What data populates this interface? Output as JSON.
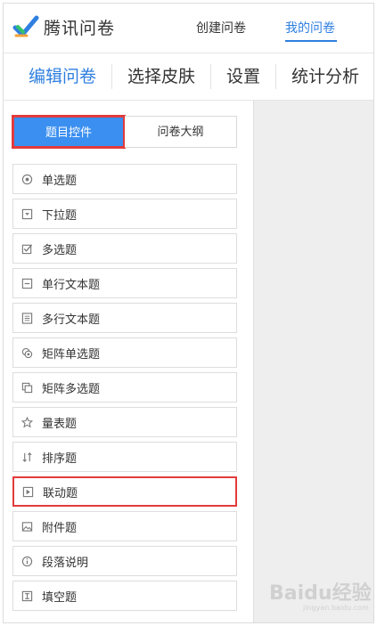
{
  "app": {
    "title": "腾讯问卷"
  },
  "topnav": {
    "create": "创建问卷",
    "mine": "我的问卷"
  },
  "tabs": [
    {
      "label": "编辑问卷",
      "active": true
    },
    {
      "label": "选择皮肤",
      "active": false
    },
    {
      "label": "设置",
      "active": false
    },
    {
      "label": "统计分析",
      "active": false
    }
  ],
  "panel": {
    "seg_controls": "题目控件",
    "seg_outline": "问卷大纲"
  },
  "question_types": [
    {
      "label": "单选题",
      "icon": "radio-icon"
    },
    {
      "label": "下拉题",
      "icon": "dropdown-icon"
    },
    {
      "label": "多选题",
      "icon": "checkbox-icon"
    },
    {
      "label": "单行文本题",
      "icon": "single-line-text-icon"
    },
    {
      "label": "多行文本题",
      "icon": "multi-line-text-icon"
    },
    {
      "label": "矩阵单选题",
      "icon": "matrix-radio-icon"
    },
    {
      "label": "矩阵多选题",
      "icon": "matrix-checkbox-icon"
    },
    {
      "label": "量表题",
      "icon": "star-icon"
    },
    {
      "label": "排序题",
      "icon": "sort-icon"
    },
    {
      "label": "联动题",
      "icon": "linkage-icon",
      "highlighted": true
    },
    {
      "label": "附件题",
      "icon": "attachment-image-icon"
    },
    {
      "label": "段落说明",
      "icon": "info-icon"
    },
    {
      "label": "填空题",
      "icon": "fill-blank-icon"
    }
  ],
  "watermark": {
    "brand": "Baidu经验",
    "sub": "jingyan.baidu.com"
  },
  "colors": {
    "accent": "#2f7fe0",
    "active_button": "#3b8ff0",
    "highlight_border": "#e23b3b"
  }
}
